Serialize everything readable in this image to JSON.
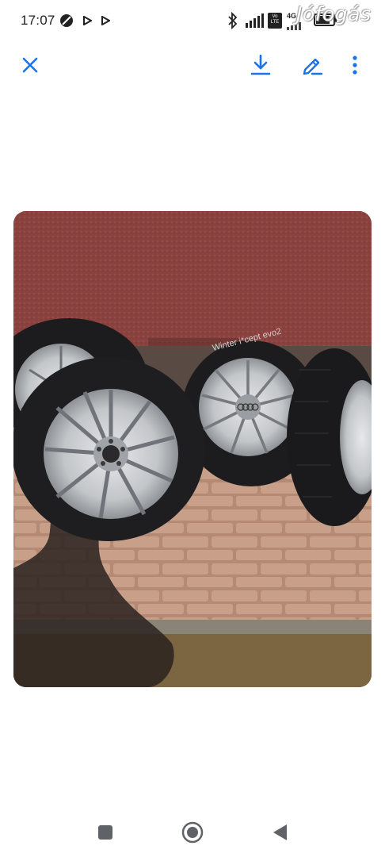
{
  "status_bar": {
    "time": "17:07",
    "network_label": "4G",
    "volte_label": "Vo LTE",
    "icons": [
      "no-disturb-icon",
      "play-icon",
      "play-icon",
      "bluetooth-icon",
      "signal-icon",
      "volte-icon",
      "wifi-icon",
      "battery-icon"
    ]
  },
  "watermark": "Jófogás",
  "toolbar": {
    "icons": [
      "close-icon",
      "download-icon",
      "edit-icon",
      "more-vert-icon"
    ],
    "accent": "#1a73e8"
  },
  "photo": {
    "subject": "four-tyres-on-alloy-wheels",
    "tyre_text": "Winter i*cept evo2"
  },
  "nav_bar": {
    "icons": [
      "recent-apps-icon",
      "home-icon",
      "back-icon"
    ],
    "color": "#5f6368"
  }
}
